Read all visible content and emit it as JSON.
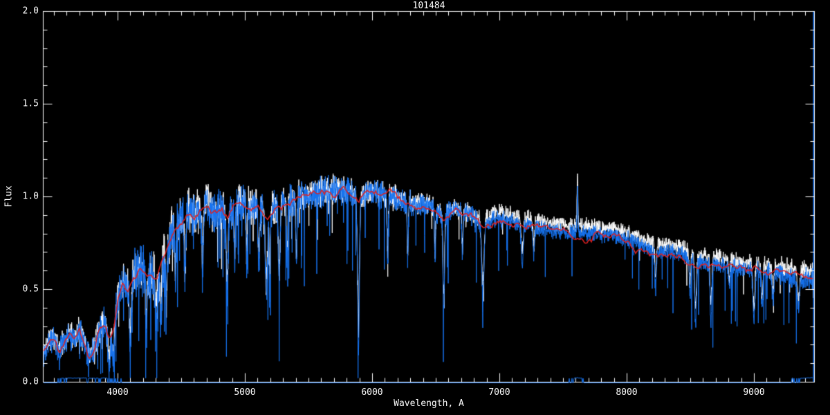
{
  "page": {
    "background_color": "#000000",
    "description": "Black-background spectral plot of object 101484: noisy white observed spectrum, blue processed spectrum overplotted, smooth red continuum fit, and a blue error trace along the zero-flux line."
  },
  "chart_data": {
    "type": "line",
    "title": "101484",
    "xlabel": "Wavelength, A",
    "ylabel": "Flux",
    "xlim": [
      3413,
      9473
    ],
    "ylim": [
      0.0,
      2.0
    ],
    "grid": false,
    "legend": "none",
    "x_major_ticks": [
      4000,
      5000,
      6000,
      7000,
      8000,
      9000
    ],
    "x_tick_labels": [
      "4000",
      "5000",
      "6000",
      "7000",
      "8000",
      "9000"
    ],
    "x_minor_step": 100,
    "y_major_ticks": [
      0.0,
      0.5,
      1.0,
      1.5,
      2.0
    ],
    "y_tick_labels": [
      "0.0",
      "0.5",
      "1.0",
      "1.5",
      "2.0"
    ],
    "y_minor_step": 0.1,
    "colors": {
      "background": "#000000",
      "axis": "#FFFFFF",
      "spectrum_white": "#FFFFFF",
      "spectrum_blue": "#1673F0",
      "continuum_red": "#E02020"
    },
    "series": [
      {
        "name": "observed spectrum",
        "color": "#FFFFFF",
        "style": "noisy line drawn beneath"
      },
      {
        "name": "processed spectrum",
        "color": "#1673F0",
        "style": "noisy line drawn on top"
      },
      {
        "name": "smoothed continuum fit",
        "color": "#E02020",
        "style": "smooth wiggly line"
      },
      {
        "name": "error spectrum",
        "color": "#1673F0",
        "style": "flat line at zero-flux axis"
      }
    ],
    "continuum": {
      "wavelength": [
        3413,
        3450,
        3500,
        3540,
        3580,
        3620,
        3660,
        3700,
        3740,
        3780,
        3820,
        3860,
        3900,
        3933,
        3968,
        4000,
        4040,
        4080,
        4120,
        4160,
        4200,
        4240,
        4305,
        4360,
        4400,
        4450,
        4500,
        4550,
        4600,
        4650,
        4700,
        4760,
        4820,
        4861,
        4920,
        4980,
        5050,
        5120,
        5175,
        5230,
        5300,
        5400,
        5500,
        5600,
        5700,
        5800,
        5893,
        5960,
        6050,
        6150,
        6250,
        6350,
        6450,
        6563,
        6650,
        6750,
        6870,
        6950,
        7050,
        7150,
        7250,
        7350,
        7450,
        7550,
        7650,
        7750,
        7850,
        7950,
        8050,
        8150,
        8250,
        8350,
        8450,
        8550,
        8650,
        8750,
        8850,
        8950,
        9050,
        9150,
        9250,
        9350,
        9473
      ],
      "flux": [
        0.15,
        0.2,
        0.23,
        0.16,
        0.22,
        0.26,
        0.22,
        0.28,
        0.2,
        0.13,
        0.17,
        0.28,
        0.32,
        0.24,
        0.27,
        0.45,
        0.54,
        0.5,
        0.56,
        0.6,
        0.62,
        0.58,
        0.56,
        0.68,
        0.76,
        0.84,
        0.88,
        0.92,
        0.89,
        0.93,
        0.95,
        0.91,
        0.94,
        0.88,
        0.95,
        0.96,
        0.94,
        0.95,
        0.89,
        0.94,
        0.96,
        0.98,
        1.0,
        1.02,
        1.03,
        1.04,
        0.97,
        1.02,
        1.01,
        0.99,
        0.97,
        0.96,
        0.95,
        0.89,
        0.93,
        0.91,
        0.85,
        0.88,
        0.87,
        0.85,
        0.84,
        0.82,
        0.81,
        0.8,
        0.8,
        0.8,
        0.79,
        0.78,
        0.76,
        0.72,
        0.7,
        0.7,
        0.68,
        0.645,
        0.64,
        0.63,
        0.615,
        0.6,
        0.6,
        0.59,
        0.57,
        0.56,
        0.55
      ]
    },
    "noise_amplitude": {
      "wavelength": [
        3413,
        3600,
        3800,
        4000,
        4150,
        4300,
        4500,
        4700,
        5000,
        5300,
        5600,
        5900,
        6200,
        6600,
        7000,
        7400,
        7800,
        8200,
        8600,
        9000,
        9300,
        9473
      ],
      "amp": [
        0.07,
        0.08,
        0.09,
        0.11,
        0.16,
        0.17,
        0.15,
        0.13,
        0.12,
        0.11,
        0.1,
        0.09,
        0.08,
        0.07,
        0.055,
        0.05,
        0.05,
        0.05,
        0.055,
        0.06,
        0.065,
        0.07
      ]
    },
    "deep_line_noise": {
      "wavelength": [
        3413,
        4000,
        4300,
        5000,
        5600,
        6200,
        6800,
        7400,
        8000,
        8400,
        8800,
        9473
      ],
      "probability": [
        0.02,
        0.05,
        0.07,
        0.06,
        0.05,
        0.04,
        0.03,
        0.02,
        0.02,
        0.04,
        0.04,
        0.05
      ],
      "magnitude": [
        0.15,
        0.3,
        0.45,
        0.5,
        0.45,
        0.4,
        0.35,
        0.25,
        0.25,
        0.4,
        0.4,
        0.35
      ]
    },
    "absorption_lines": [
      [
        3933,
        0.05,
        8
      ],
      [
        3968,
        0.08,
        7
      ],
      [
        4101,
        0.22,
        7
      ],
      [
        4226,
        0.28,
        6
      ],
      [
        4305,
        0.36,
        9
      ],
      [
        4340,
        0.32,
        7
      ],
      [
        4383,
        0.42,
        6
      ],
      [
        4455,
        0.55,
        5
      ],
      [
        4531,
        0.58,
        6
      ],
      [
        4668,
        0.6,
        6
      ],
      [
        4861,
        0.5,
        7
      ],
      [
        4920,
        0.66,
        5
      ],
      [
        5015,
        0.64,
        5
      ],
      [
        5110,
        0.62,
        6
      ],
      [
        5170,
        0.48,
        9
      ],
      [
        5196,
        0.42,
        4
      ],
      [
        5270,
        0.55,
        7
      ],
      [
        5332,
        0.64,
        5
      ],
      [
        5405,
        0.66,
        5
      ],
      [
        5893,
        0.18,
        7
      ],
      [
        6122,
        0.66,
        5
      ],
      [
        6280,
        0.68,
        5
      ],
      [
        6495,
        0.67,
        5
      ],
      [
        6563,
        0.35,
        6
      ],
      [
        6710,
        0.7,
        5
      ],
      [
        6870,
        0.45,
        9
      ],
      [
        7180,
        0.62,
        8
      ],
      [
        7270,
        0.68,
        6
      ],
      [
        8227,
        0.5,
        6
      ],
      [
        8498,
        0.45,
        6
      ],
      [
        8542,
        0.3,
        7
      ],
      [
        8662,
        0.33,
        7
      ],
      [
        8807,
        0.5,
        6
      ],
      [
        9000,
        0.33,
        8
      ],
      [
        9064,
        0.4,
        7
      ],
      [
        9150,
        0.45,
        8
      ],
      [
        9350,
        0.38,
        8
      ]
    ],
    "emission_spikes": [
      [
        7614,
        1.07,
        4,
        1.03
      ]
    ],
    "white_blue_offset": {
      "wavelength": [
        3413,
        6800,
        7000,
        9473
      ],
      "offset": [
        0.0,
        0.0,
        0.03,
        0.03
      ]
    },
    "error_level": {
      "wavelength": [
        3413,
        3600,
        3900,
        4100,
        4400,
        4800,
        5200,
        7500,
        7614,
        7700,
        9200,
        9473
      ],
      "flux": [
        0.012,
        0.02,
        0.019,
        0.015,
        0.012,
        0.01,
        0.008,
        0.012,
        0.022,
        0.012,
        0.015,
        0.022
      ]
    },
    "edge_artifact": {
      "wavelength": 9465,
      "bottom_flux": 0.0,
      "top_flux": 2.0
    }
  }
}
